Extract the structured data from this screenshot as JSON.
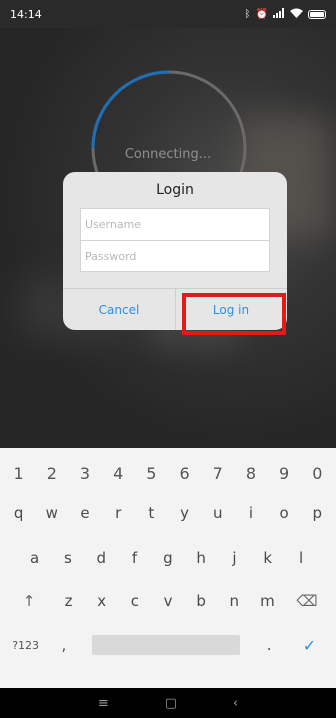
{
  "status_bar": {
    "time": "14:14",
    "icons": [
      "bluetooth-icon",
      "alarm-icon",
      "signal-icon",
      "wifi-icon",
      "battery-icon"
    ]
  },
  "overlay": {
    "connecting_text": "Connecting..."
  },
  "dialog": {
    "title": "Login",
    "username_placeholder": "Username",
    "username_value": "",
    "password_placeholder": "Password",
    "password_value": "",
    "cancel_label": "Cancel",
    "login_label": "Log in"
  },
  "keyboard": {
    "number_row": [
      "1",
      "2",
      "3",
      "4",
      "5",
      "6",
      "7",
      "8",
      "9",
      "0"
    ],
    "row_q": [
      "q",
      "w",
      "e",
      "r",
      "t",
      "y",
      "u",
      "i",
      "o",
      "p"
    ],
    "row_a": [
      "a",
      "s",
      "d",
      "f",
      "g",
      "h",
      "j",
      "k",
      "l"
    ],
    "row_z": [
      "z",
      "x",
      "c",
      "v",
      "b",
      "n",
      "m"
    ],
    "shift_glyph": "↑",
    "backspace_glyph": "⌫",
    "symbols_label": "?123",
    "comma": ",",
    "period": ".",
    "enter_glyph": "✓"
  },
  "nav_bar": {
    "menu_glyph": "≡",
    "home_glyph": "▢",
    "back_glyph": "‹"
  },
  "colors": {
    "accent": "#2f8ee0",
    "highlight": "#e21a1a",
    "dialog_bg": "#e6e6e6",
    "keyboard_bg": "#f3f3f3"
  }
}
